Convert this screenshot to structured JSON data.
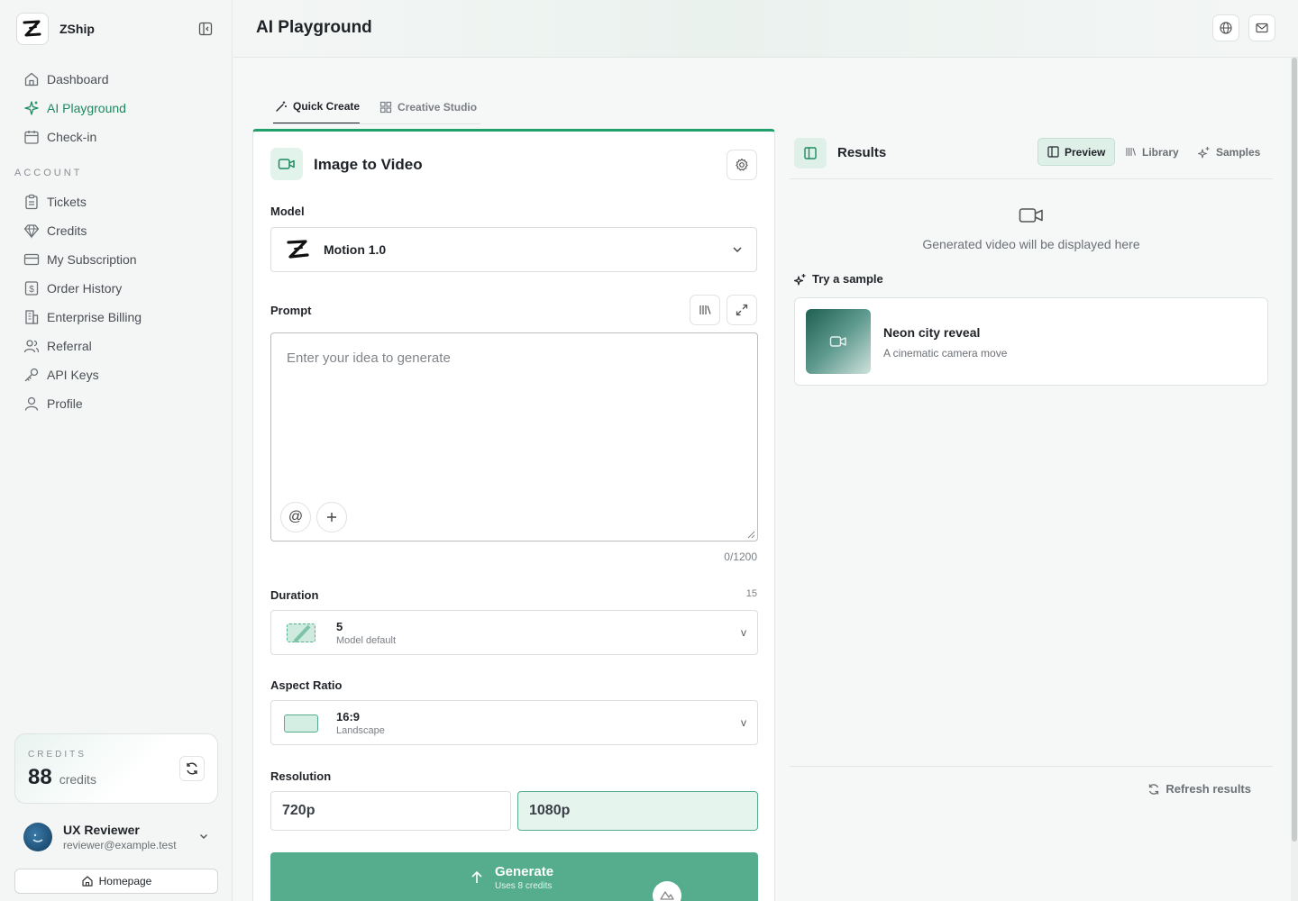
{
  "brand": {
    "name": "ZShip"
  },
  "sidebar": {
    "main_items": [
      {
        "label": "Dashboard",
        "icon": "home-icon"
      },
      {
        "label": "AI Playground",
        "icon": "sparkles-icon",
        "active": true
      },
      {
        "label": "Check-in",
        "icon": "calendar-icon"
      }
    ],
    "account_label": "ACCOUNT",
    "account_items": [
      {
        "label": "Tickets",
        "icon": "clipboard-icon"
      },
      {
        "label": "Credits",
        "icon": "gem-icon"
      },
      {
        "label": "My Subscription",
        "icon": "card-icon"
      },
      {
        "label": "Order History",
        "icon": "receipt-icon"
      },
      {
        "label": "Enterprise Billing",
        "icon": "building-icon"
      },
      {
        "label": "Referral",
        "icon": "users-icon"
      },
      {
        "label": "API Keys",
        "icon": "key-icon"
      },
      {
        "label": "Profile",
        "icon": "user-icon"
      }
    ],
    "credits": {
      "label": "CREDITS",
      "value": "88",
      "unit": "credits"
    },
    "user": {
      "name": "UX Reviewer",
      "email": "reviewer@example.test"
    },
    "homepage_label": "Homepage"
  },
  "header": {
    "title": "AI Playground"
  },
  "tabs": [
    {
      "label": "Quick Create",
      "active": true
    },
    {
      "label": "Creative Studio",
      "active": false
    }
  ],
  "form": {
    "title": "Image to Video",
    "model_label": "Model",
    "model_value": "Motion 1.0",
    "prompt_label": "Prompt",
    "prompt_placeholder": "Enter your idea to generate",
    "char_count": "0/1200",
    "duration_label": "Duration",
    "duration_max": "15",
    "duration_value": "5",
    "duration_sub": "Model default",
    "aspect_label": "Aspect Ratio",
    "aspect_value": "16:9",
    "aspect_sub": "Landscape",
    "resolution_label": "Resolution",
    "resolutions": [
      "720p",
      "1080p"
    ],
    "selected_resolution": "1080p",
    "generate_label": "Generate",
    "generate_sub": "Uses 8 credits",
    "caret": "v"
  },
  "results": {
    "title": "Results",
    "tabs": [
      "Preview",
      "Library",
      "Samples"
    ],
    "empty_text": "Generated video will be displayed here",
    "try_sample_label": "Try a sample",
    "sample": {
      "title": "Neon city reveal",
      "subtitle": "A cinematic camera move"
    },
    "refresh_label": "Refresh results"
  },
  "colors": {
    "accent": "#1b8a5f",
    "generate": "#55ad8e",
    "accent_bg": "#dff0e9"
  }
}
